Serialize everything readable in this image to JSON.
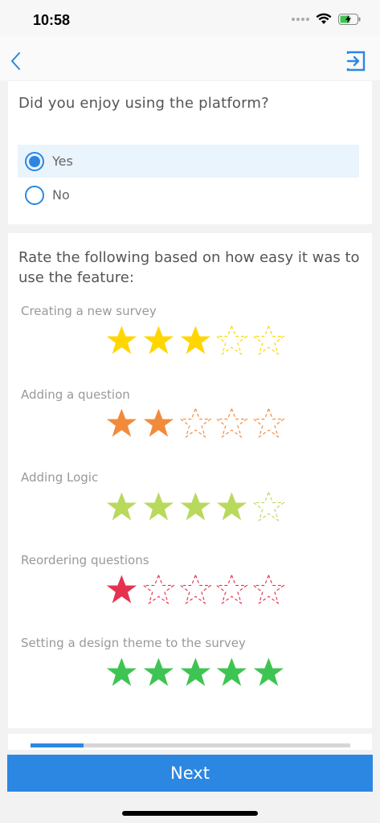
{
  "status": {
    "time": "10:58"
  },
  "nav": {
    "back_icon": "chevron-left-icon",
    "exit_icon": "exit-icon"
  },
  "question1": {
    "text": "Did you enjoy using the platform?",
    "options": [
      {
        "label": "Yes",
        "selected": true
      },
      {
        "label": "No",
        "selected": false
      }
    ]
  },
  "question2": {
    "text": "Rate the following based on how easy it was to use the feature:",
    "items": [
      {
        "label": "Creating a new survey",
        "rating": 3,
        "max": 5,
        "color": "#ffd600"
      },
      {
        "label": "Adding a question",
        "rating": 2,
        "max": 5,
        "color": "#f28a3c"
      },
      {
        "label": "Adding Logic",
        "rating": 4,
        "max": 5,
        "color": "#b9d95c"
      },
      {
        "label": "Reordering questions",
        "rating": 1,
        "max": 5,
        "color": "#e5334f"
      },
      {
        "label": "Setting a design theme to the survey",
        "rating": 5,
        "max": 5,
        "color": "#3ec452"
      }
    ]
  },
  "progress": {
    "fraction": 0.165,
    "color": "#2b87e2"
  },
  "footer": {
    "next_label": "Next"
  },
  "colors": {
    "accent": "#2b87e2"
  }
}
